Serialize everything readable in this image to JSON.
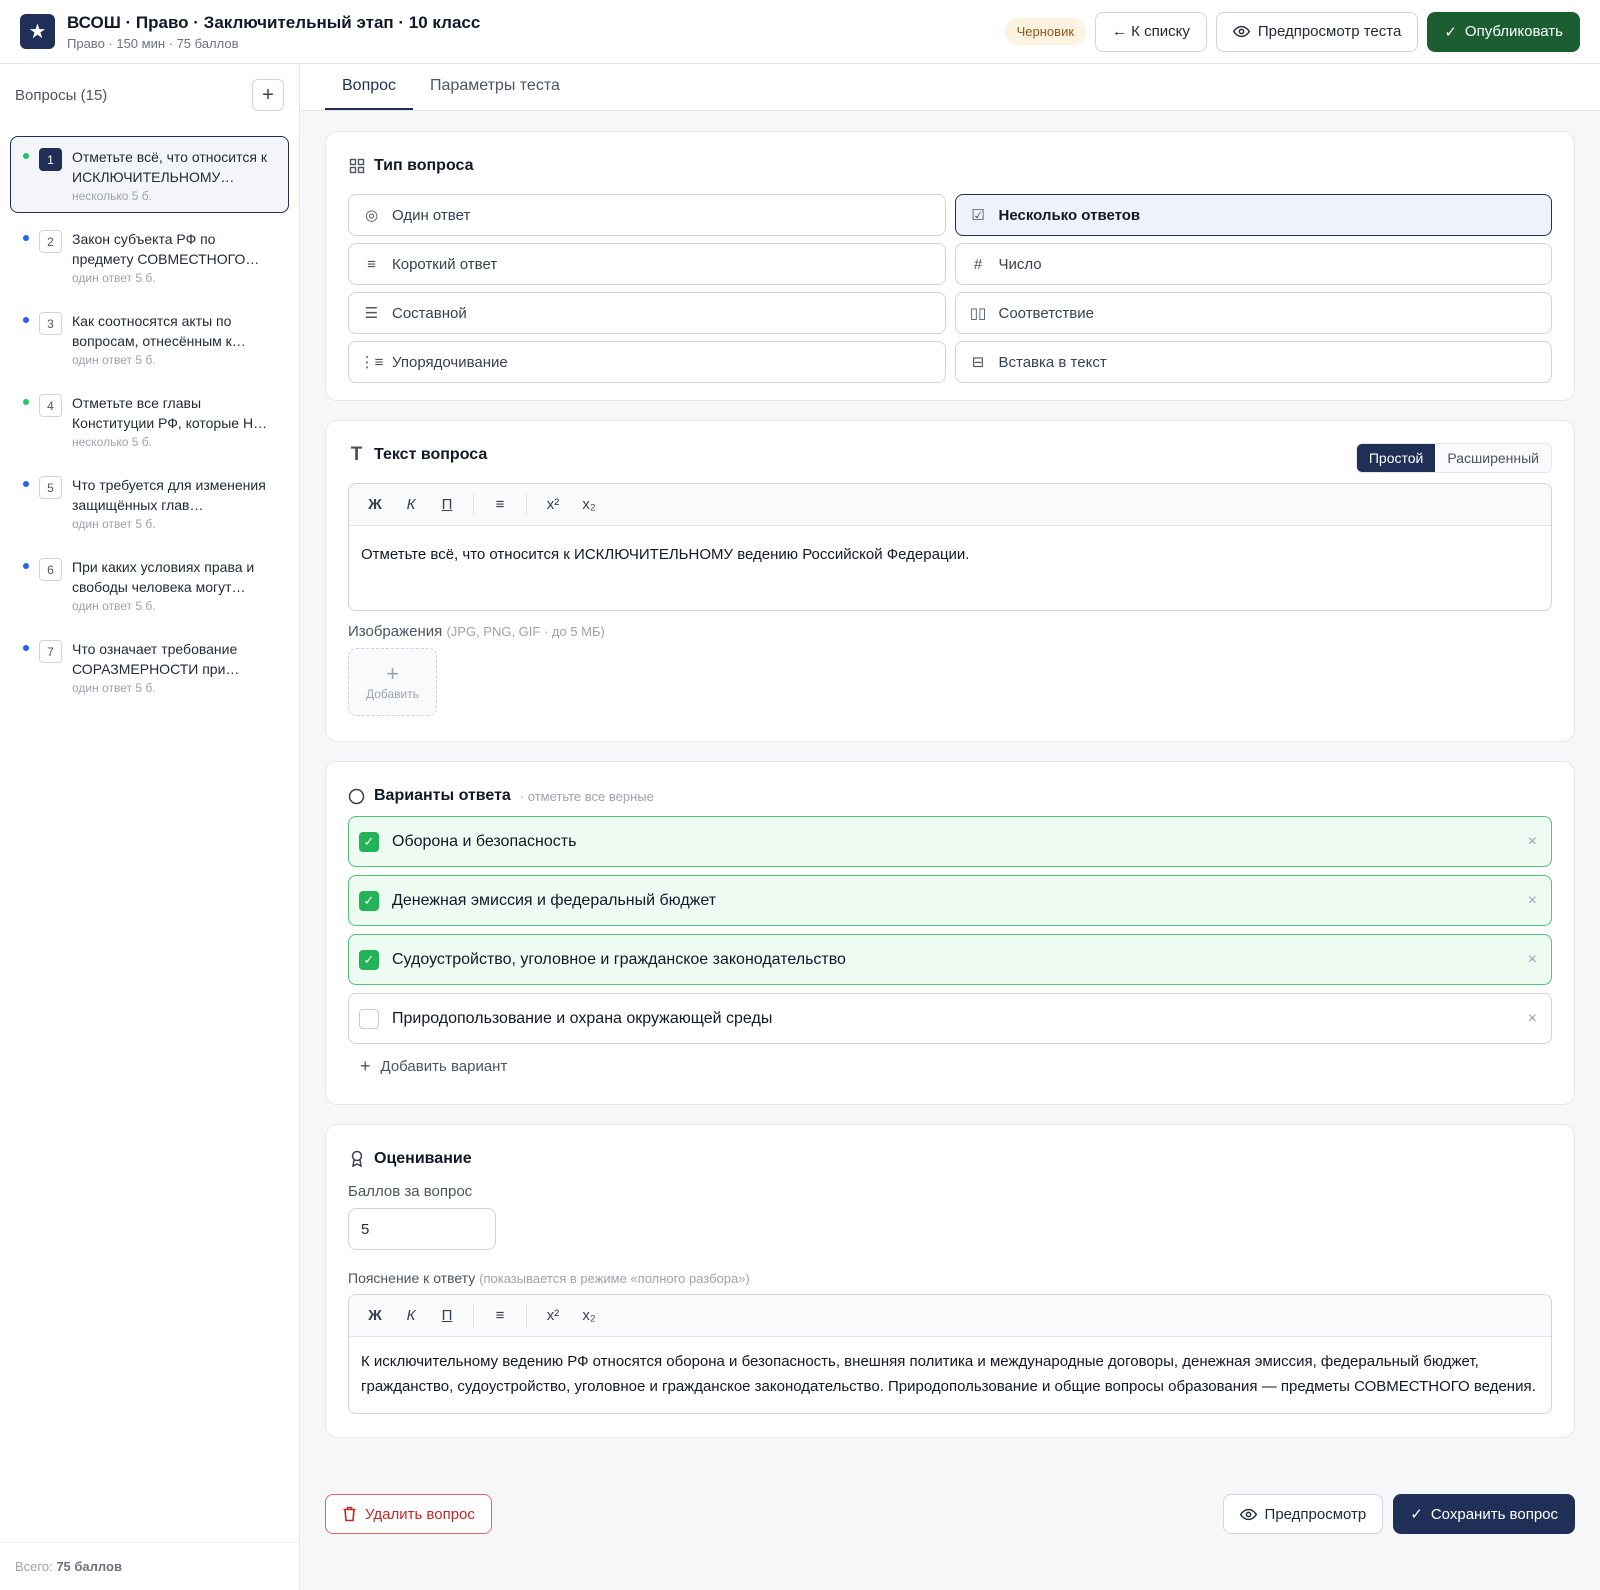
{
  "header": {
    "logo_glyph": "★",
    "title": "ВСОШ · Право · Заключительный этап · 10 класс",
    "subtitle": "Право · 150 мин · 75 баллов",
    "status": "Черновик",
    "back_label": "← К списку",
    "preview_label": "Предпросмотр теста",
    "publish_label": "Опубликовать"
  },
  "sidebar": {
    "title": "Вопросы (15)",
    "add_glyph": "+",
    "items": [
      {
        "num": "1",
        "text": "Отметьте всё, что относится к ИСКЛЮЧИТЕЛЬНОМУ…",
        "meta": "несколько  5 б.",
        "dot": "#22c55e"
      },
      {
        "num": "2",
        "text": "Закон субъекта РФ по предмету СОВМЕСТНОГО…",
        "meta": "один ответ  5 б.",
        "dot": "#2563eb"
      },
      {
        "num": "3",
        "text": "Как соотносятся акты по вопросам, отнесённым к…",
        "meta": "один ответ  5 б.",
        "dot": "#2563eb"
      },
      {
        "num": "4",
        "text": "Отметьте все главы Конституции РФ, которые Н…",
        "meta": "несколько  5 б.",
        "dot": "#22c55e"
      },
      {
        "num": "5",
        "text": "Что требуется для изменения защищённых глав…",
        "meta": "один ответ  5 б.",
        "dot": "#2563eb"
      },
      {
        "num": "6",
        "text": "При каких условиях права и свободы человека могут…",
        "meta": "один ответ  5 б.",
        "dot": "#2563eb"
      },
      {
        "num": "7",
        "text": "Что означает требование СОРАЗМЕРНОСТИ при…",
        "meta": "один ответ  5 б.",
        "dot": "#2563eb"
      }
    ],
    "footer_prefix": "Всего: ",
    "footer_total": "75 баллов"
  },
  "tabs": [
    {
      "label": "Вопрос"
    },
    {
      "label": "Параметры теста"
    }
  ],
  "question_type": {
    "title": "Тип вопроса",
    "options": [
      {
        "label": "Один ответ",
        "icon": "◎"
      },
      {
        "label": "Несколько ответов",
        "icon": "☑"
      },
      {
        "label": "Короткий ответ",
        "icon": "≡"
      },
      {
        "label": "Число",
        "icon": "#"
      },
      {
        "label": "Составной",
        "icon": "☰"
      },
      {
        "label": "Соответствие",
        "icon": "▯▯"
      },
      {
        "label": "Упорядочивание",
        "icon": "⋮≡"
      },
      {
        "label": "Вставка в текст",
        "icon": "⊟"
      }
    ]
  },
  "question_text": {
    "title": "Текст вопроса",
    "mode_simple": "Простой",
    "mode_extended": "Расширенный",
    "toolbar": {
      "bold": "Ж",
      "italic": "К",
      "underline": "П",
      "list": "≡",
      "sup": "x²",
      "sub": "x₂"
    },
    "content": "Отметьте всё, что относится к ИСКЛЮЧИТЕЛЬНОМУ ведению Российской Федерации.",
    "images_label": "Изображения",
    "images_hint": "(JPG, PNG, GIF · до 5 МБ)",
    "add_image_label": "Добавить"
  },
  "answers": {
    "title": "Варианты ответа",
    "hint": "· отметьте все верные",
    "check_glyph": "✓",
    "remove_glyph": "×",
    "options": [
      {
        "text": "Оборона и безопасность",
        "correct": true
      },
      {
        "text": "Денежная эмиссия и федеральный бюджет",
        "correct": true
      },
      {
        "text": "Судоустройство, уголовное и гражданское законодательство",
        "correct": true
      },
      {
        "text": "Природопользование и охрана окружающей среды",
        "correct": false
      }
    ],
    "add_label": "Добавить вариант"
  },
  "grading": {
    "title": "Оценивание",
    "points_label": "Баллов за вопрос",
    "points_value": "5",
    "explanation_label": "Пояснение к ответу",
    "explanation_hint": "(показывается в режиме «полного разбора»)",
    "explanation_text": "К исключительному ведению РФ относятся оборона и безопасность, внешняя политика и международные договоры, денежная эмиссия, федеральный бюджет, гражданство, судоустройство, уголовное и гражданское законодательство. Природопользование и общие вопросы образования — предметы СОВМЕСТНОГО ведения."
  },
  "footer": {
    "delete_label": "Удалить вопрос",
    "preview_label": "Предпросмотр",
    "save_label": "Сохранить вопрос"
  },
  "colors": {
    "brand": "#1f2f57",
    "publish": "#1a5e32",
    "correct": "#22b356",
    "danger": "#c02929"
  }
}
